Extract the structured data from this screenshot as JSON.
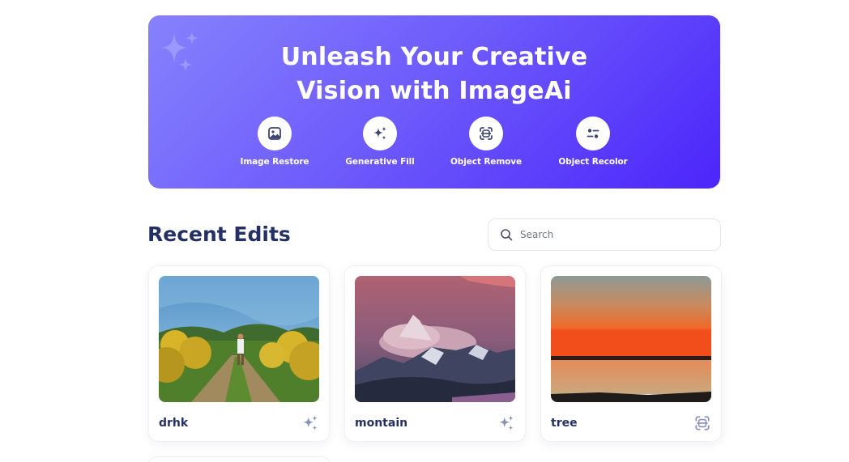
{
  "hero": {
    "title_line1": "Unleash Your Creative",
    "title_line2": "Vision with ImageAi",
    "gradient_start": "#8682fd",
    "gradient_end": "#4c25fb",
    "tools": [
      {
        "label": "Image Restore",
        "icon": "image-icon"
      },
      {
        "label": "Generative Fill",
        "icon": "sparkles-icon"
      },
      {
        "label": "Object Remove",
        "icon": "scan-object-icon"
      },
      {
        "label": "Object Recolor",
        "icon": "recolor-icon"
      }
    ]
  },
  "recent": {
    "title": "Recent Edits",
    "search_placeholder": "Search",
    "items": [
      {
        "name": "drhk",
        "image": "meadow-path-photo",
        "icon": "sparkles-icon"
      },
      {
        "name": "montain",
        "image": "mountain-clouds-photo",
        "icon": "sparkles-icon"
      },
      {
        "name": "tree",
        "image": "sunset-lake-photo",
        "icon": "scan-object-icon"
      }
    ]
  },
  "colors": {
    "title": "#243063",
    "icon": "#8a94b8",
    "tool_icon": "#3d4470"
  }
}
